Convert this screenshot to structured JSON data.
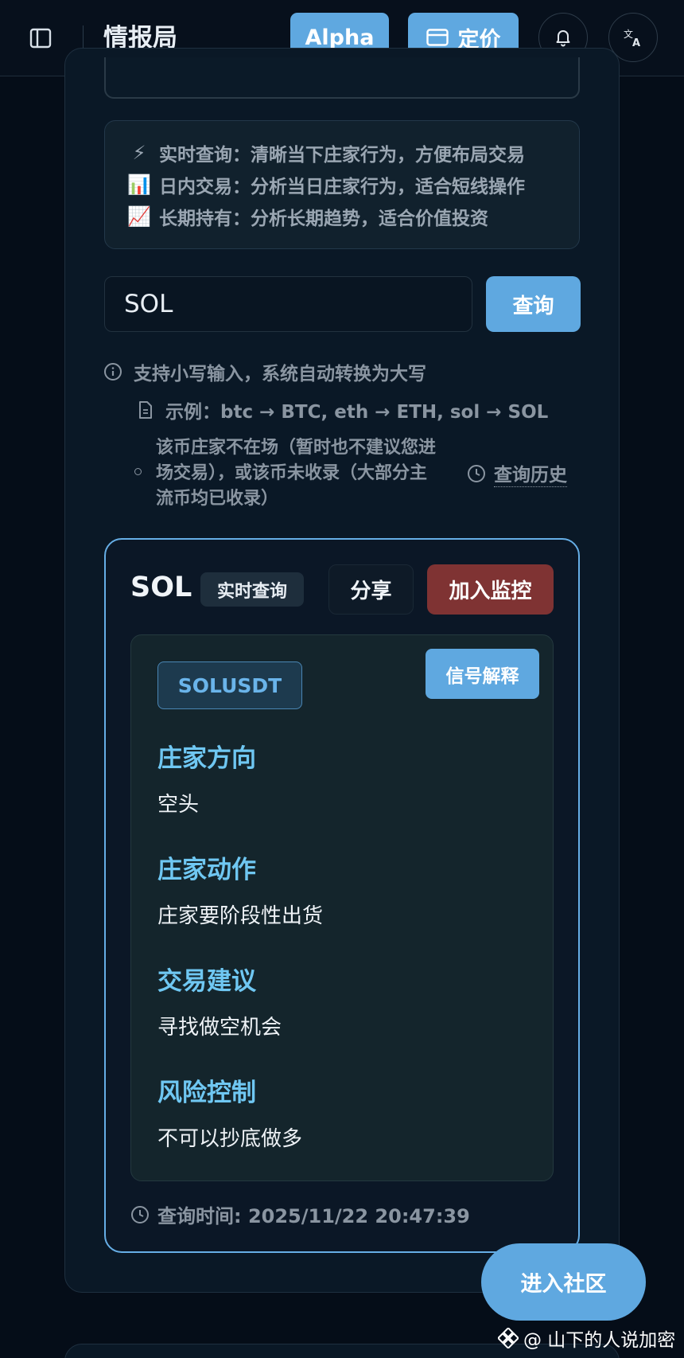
{
  "header": {
    "title": "情报局",
    "alpha_label": "Alpha",
    "pricing_label": "定价"
  },
  "modes": [
    {
      "emoji": "⚡",
      "text": "实时查询：清晰当下庄家行为，方便布局交易"
    },
    {
      "emoji": "📊",
      "text": "日内交易：分析当日庄家行为，适合短线操作"
    },
    {
      "emoji": "📈",
      "text": "长期持有：分析长期趋势，适合价值投资"
    }
  ],
  "search": {
    "value": "SOL",
    "button_label": "查询"
  },
  "hints": {
    "lowercase": "支持小写输入，系统自动转换为大写",
    "example": "示例：btc → BTC, eth → ETH, sol → SOL",
    "notice": "该币庄家不在场（暂时也不建议您进场交易），或该币未收录（大部分主流币均已收录）",
    "history_link": "查询历史"
  },
  "result": {
    "symbol": "SOL",
    "mode_badge": "实时查询",
    "share_label": "分享",
    "monitor_label": "加入监控",
    "pair": "SOLUSDT",
    "explain_label": "信号解释",
    "signals": [
      {
        "heading": "庄家方向",
        "value": "空头"
      },
      {
        "heading": "庄家动作",
        "value": "庄家要阶段性出货"
      },
      {
        "heading": "交易建议",
        "value": "寻找做空机会"
      },
      {
        "heading": "风险控制",
        "value": "不可以抄底做多"
      }
    ],
    "query_time": "查询时间: 2025/11/22 20:47:39"
  },
  "community_label": "进入社区",
  "watermark": "@ 山下的人说加密",
  "colors": {
    "accent": "#5fa8e0",
    "danger": "#7f3333",
    "signal_heading": "#6fc7f2"
  }
}
